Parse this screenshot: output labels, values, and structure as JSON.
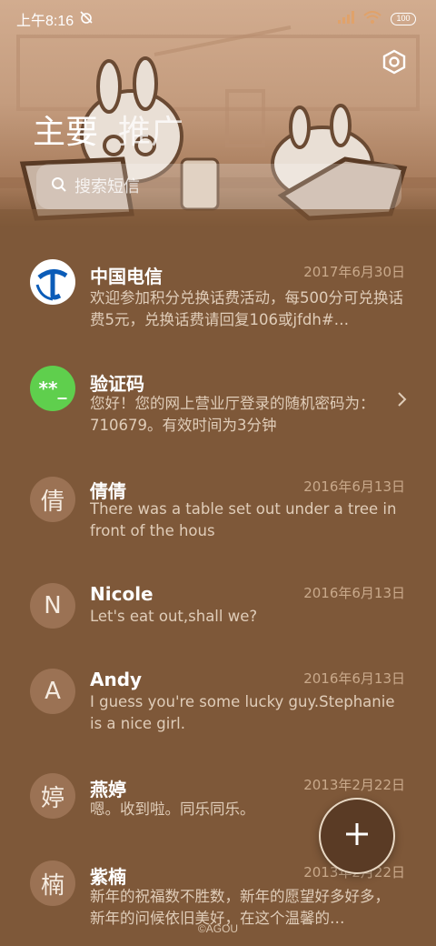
{
  "status_bar": {
    "time": "上午8:16",
    "battery": "100"
  },
  "header": {
    "tabs": [
      {
        "label": "主要"
      },
      {
        "label": "推广"
      }
    ],
    "search": {
      "placeholder": "搜索短信",
      "value": ""
    }
  },
  "messages": [
    {
      "name": "中国电信",
      "date": "2017年6月30日",
      "preview": "欢迎参加积分兑换话费活动，每500分可兑换话费5元，兑换话费请回复106或jfdh#…",
      "avatar": "telecom-logo"
    },
    {
      "name": "验证码",
      "date": "",
      "preview": "您好！您的网上营业厅登录的随机密码为：710679。有效时间为3分钟",
      "avatar_text": "**_"
    },
    {
      "name": "倩倩",
      "date": "2016年6月13日",
      "preview": "There was a table set out under a tree in front of the hous",
      "avatar_text": "倩"
    },
    {
      "name": "Nicole",
      "date": "2016年6月13日",
      "preview": "Let's eat out,shall we?",
      "avatar_text": "N"
    },
    {
      "name": "Andy",
      "date": "2016年6月13日",
      "preview": "I guess you're some lucky guy.Stephanie is a nice girl.",
      "avatar_text": "A"
    },
    {
      "name": "燕婷",
      "date": "2013年2月22日",
      "preview": "嗯。收到啦。同乐同乐。",
      "avatar_text": "婷"
    },
    {
      "name": "紫楠",
      "date": "2013年2月22日",
      "preview": "新年的祝福数不胜数，新年的愿望好多好多，新年的问候依旧美好，在这个温馨的…",
      "avatar_text": "楠"
    }
  ],
  "fab": {
    "icon": "plus-icon"
  },
  "watermark": "©AGOU"
}
